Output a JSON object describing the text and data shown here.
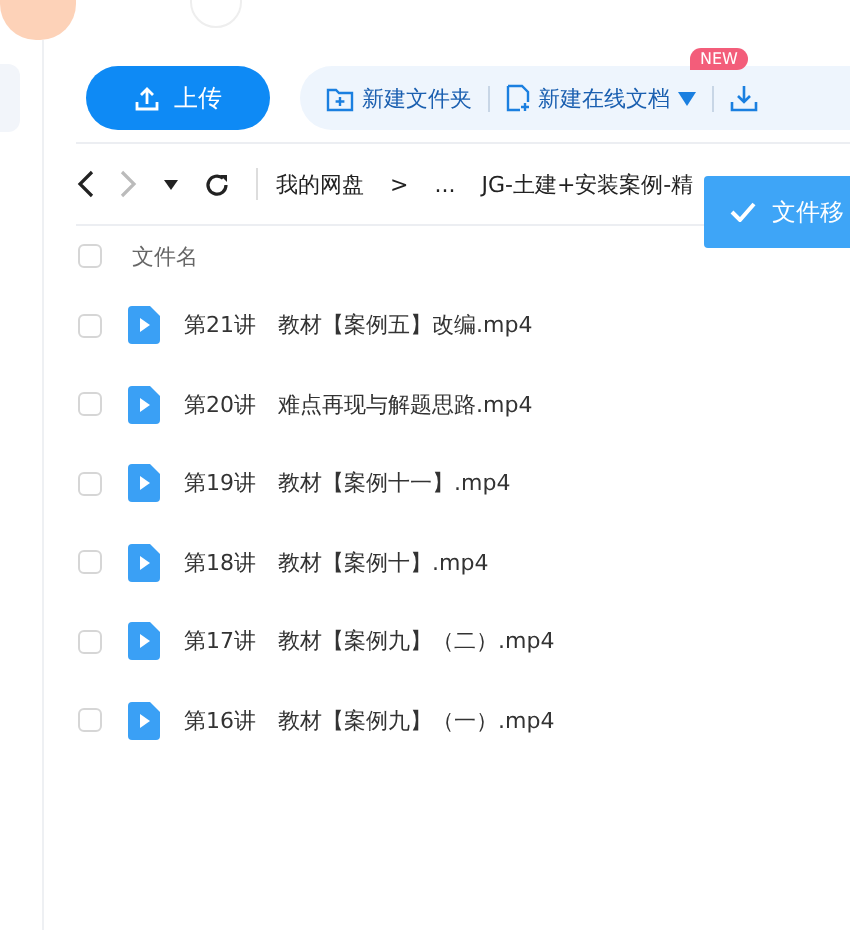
{
  "toolbar": {
    "upload": "上传",
    "actions": [
      {
        "kind": "folder",
        "label": "新建文件夹"
      },
      {
        "kind": "doc",
        "label": "新建在线文档",
        "badge": "NEW",
        "dropdown": true
      },
      {
        "kind": "download"
      }
    ]
  },
  "nav": {
    "breadcrumb": [
      "我的网盘",
      ">",
      "...",
      "JG-土建+安装案例-精"
    ]
  },
  "toast": {
    "text": "文件移"
  },
  "table": {
    "header": "文件名",
    "all_checked": false,
    "rows": [
      {
        "name": "第21讲　教材【案例五】改编.mp4",
        "checked": false
      },
      {
        "name": "第20讲　难点再现与解题思路.mp4",
        "checked": false
      },
      {
        "name": "第19讲　教材【案例十一】.mp4",
        "checked": false
      },
      {
        "name": "第18讲　教材【案例十】.mp4",
        "checked": false
      },
      {
        "name": "第17讲　教材【案例九】（二）.mp4",
        "checked": false
      },
      {
        "name": "第16讲　教材【案例九】（一）.mp4",
        "checked": false
      }
    ]
  }
}
